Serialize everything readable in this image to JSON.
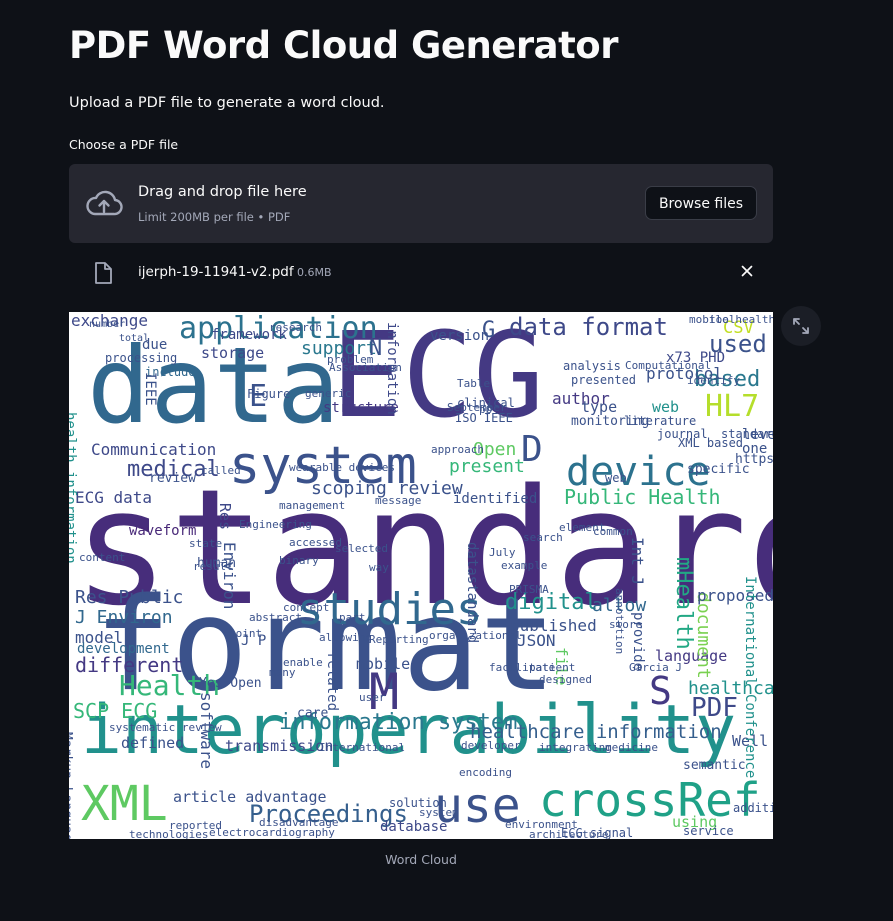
{
  "page": {
    "title": "PDF Word Cloud Generator",
    "description": "Upload a PDF file to generate a word cloud."
  },
  "uploader": {
    "label": "Choose a PDF file",
    "dropzone_text": "Drag and drop file here",
    "limit_text": "Limit 200MB per file • PDF",
    "browse_label": "Browse files",
    "upload_icon": "cloud-upload-icon"
  },
  "file": {
    "name": "ijerph-19-11941-v2.pdf",
    "size": "0.6MB",
    "icon": "file-icon",
    "remove_icon": "close-icon"
  },
  "wordcloud": {
    "caption": "Word Cloud",
    "expand_icon": "fullscreen-expand-icon",
    "background": "#ffffff",
    "palette": "viridis",
    "words": [
      {
        "text": "standard",
        "color": "#472d7b"
      },
      {
        "text": "format",
        "color": "#3b528b"
      },
      {
        "text": "data",
        "color": "#31688e"
      },
      {
        "text": "ECG",
        "color": "#443983"
      },
      {
        "text": "interoperability",
        "color": "#21918c"
      },
      {
        "text": "system",
        "color": "#3b528b"
      },
      {
        "text": "studies",
        "color": "#31688e"
      },
      {
        "text": "device",
        "color": "#2c728e"
      },
      {
        "text": "crossRef",
        "color": "#1fa187"
      },
      {
        "text": "use",
        "color": "#3b528b"
      },
      {
        "text": "XML",
        "color": "#5ec962"
      },
      {
        "text": "application",
        "color": "#2c728e"
      },
      {
        "text": "data format",
        "color": "#3e4989"
      },
      {
        "text": "information system",
        "color": "#2a788e"
      },
      {
        "text": "Health",
        "color": "#35b779"
      },
      {
        "text": "Proceedings",
        "color": "#355f8d"
      },
      {
        "text": "HL7",
        "color": "#b5de2b"
      },
      {
        "text": "used",
        "color": "#3b528b"
      },
      {
        "text": "based",
        "color": "#2a788e"
      },
      {
        "text": "medical",
        "color": "#3e4989"
      },
      {
        "text": "Public Health",
        "color": "#35b779"
      },
      {
        "text": "scoping review",
        "color": "#3b528b"
      },
      {
        "text": "digital",
        "color": "#21918c"
      },
      {
        "text": "SCP ECG",
        "color": "#35b779"
      },
      {
        "text": "different",
        "color": "#443983"
      },
      {
        "text": "PDF",
        "color": "#3e4989"
      },
      {
        "text": "Res Public",
        "color": "#3b528b"
      },
      {
        "text": "J Environ",
        "color": "#31688e"
      },
      {
        "text": "mHealth",
        "color": "#22a884"
      },
      {
        "text": "healthcare information",
        "color": "#355f8d"
      },
      {
        "text": "exchange",
        "color": "#3e4989"
      },
      {
        "text": "support",
        "color": "#2a788e"
      },
      {
        "text": "Communication",
        "color": "#3e4989"
      },
      {
        "text": "ECG data",
        "color": "#3e4989"
      },
      {
        "text": "article advantage",
        "color": "#3b528b"
      },
      {
        "text": "published",
        "color": "#3b528b"
      },
      {
        "text": "language",
        "color": "#443983"
      },
      {
        "text": "document",
        "color": "#7ad151"
      },
      {
        "text": "healthcare",
        "color": "#21918c"
      },
      {
        "text": "model",
        "color": "#3b528b"
      },
      {
        "text": "waveform",
        "color": "#482878"
      },
      {
        "text": "author",
        "color": "#443983"
      },
      {
        "text": "web",
        "color": "#21918c"
      },
      {
        "text": "present",
        "color": "#35b779"
      },
      {
        "text": "allow",
        "color": "#31688e"
      },
      {
        "text": "proposed",
        "color": "#3b528b"
      },
      {
        "text": "database",
        "color": "#3e4989"
      },
      {
        "text": "JSON",
        "color": "#3b528b"
      },
      {
        "text": "storage",
        "color": "#3e4989"
      },
      {
        "text": "protocol",
        "color": "#3b528b"
      },
      {
        "text": "framework",
        "color": "#3e4989"
      },
      {
        "text": "mobile",
        "color": "#3b528b"
      },
      {
        "text": "Open",
        "color": "#5ec962"
      },
      {
        "text": "x73 PHD",
        "color": "#3e4989"
      },
      {
        "text": "version",
        "color": "#3b528b"
      },
      {
        "text": "CSV",
        "color": "#c2df23"
      },
      {
        "text": "structure",
        "color": "#443983"
      },
      {
        "text": "transmission",
        "color": "#3e4989"
      },
      {
        "text": "development",
        "color": "#31688e"
      },
      {
        "text": "identified",
        "color": "#3b528b"
      },
      {
        "text": "due",
        "color": "#3b528b"
      },
      {
        "text": "processing",
        "color": "#3b528b"
      },
      {
        "text": "include",
        "color": "#31688e"
      },
      {
        "text": "level",
        "color": "#3b528b"
      },
      {
        "text": "one",
        "color": "#3b528b"
      },
      {
        "text": "file",
        "color": "#5ec962"
      },
      {
        "text": "defined",
        "color": "#3b528b"
      },
      {
        "text": "Well",
        "color": "#3b528b"
      },
      {
        "text": "using",
        "color": "#5ec962"
      },
      {
        "text": "M",
        "color": "#443983"
      },
      {
        "text": "S",
        "color": "#443983"
      },
      {
        "text": "D",
        "color": "#3b528b"
      },
      {
        "text": "E",
        "color": "#3b528b"
      },
      {
        "text": "N",
        "color": "#3b528b"
      },
      {
        "text": "G",
        "color": "#3b528b"
      },
      {
        "text": "Res",
        "color": "#3e4989"
      },
      {
        "text": "Environ",
        "color": "#3b528b"
      },
      {
        "text": "information",
        "color": "#3e4989"
      },
      {
        "text": "International Conference",
        "color": "#21918c"
      },
      {
        "text": "Int J",
        "color": "#3b528b"
      },
      {
        "text": "provide",
        "color": "#3b528b"
      },
      {
        "text": "datastandard",
        "color": "#3b528b"
      },
      {
        "text": "software",
        "color": "#3b528b"
      },
      {
        "text": "related",
        "color": "#3b528b"
      },
      {
        "text": "IEEE",
        "color": "#3b528b"
      },
      {
        "text": "health information",
        "color": "#21918c"
      },
      {
        "text": "Markup Language",
        "color": "#3b528b"
      },
      {
        "text": "human",
        "color": "#3b528b"
      },
      {
        "text": "review",
        "color": "#3b528b"
      },
      {
        "text": "care",
        "color": "#3b528b"
      },
      {
        "text": "Yes Open",
        "color": "#3b528b"
      },
      {
        "text": "specific",
        "color": "#3b528b"
      },
      {
        "text": "https",
        "color": "#3b528b"
      },
      {
        "text": "semantic",
        "color": "#3b528b"
      },
      {
        "text": "addition",
        "color": "#3b528b"
      },
      {
        "text": "service",
        "color": "#3b528b"
      },
      {
        "text": "solution",
        "color": "#3b528b"
      },
      {
        "text": "architecture",
        "color": "#3b528b"
      },
      {
        "text": "ECG signal",
        "color": "#3b528b"
      },
      {
        "text": "electrocardiography",
        "color": "#3b528b"
      },
      {
        "text": "J P",
        "color": "#3b528b"
      },
      {
        "text": "Figure",
        "color": "#3b528b"
      },
      {
        "text": "web",
        "color": "#3b528b"
      },
      {
        "text": "monitoring",
        "color": "#3b528b"
      },
      {
        "text": "mobile health",
        "color": "#3b528b"
      },
      {
        "text": "analysis",
        "color": "#3b528b"
      },
      {
        "text": "ISO IEEE",
        "color": "#3b528b"
      },
      {
        "text": "clinical",
        "color": "#3b528b"
      },
      {
        "text": "standardization",
        "color": "#3b528b"
      },
      {
        "text": "literature",
        "color": "#3b528b"
      },
      {
        "text": "journal",
        "color": "#3b528b"
      },
      {
        "text": "XML based",
        "color": "#3b528b"
      },
      {
        "text": "type",
        "color": "#3b528b"
      },
      {
        "text": "tool",
        "color": "#3b528b"
      },
      {
        "text": "presented",
        "color": "#3b528b"
      },
      {
        "text": "identify",
        "color": "#3b528b"
      },
      {
        "text": "Table",
        "color": "#3b528b"
      },
      {
        "text": "September",
        "color": "#3b528b"
      },
      {
        "text": "pp",
        "color": "#3b528b"
      },
      {
        "text": "Association",
        "color": "#3b528b"
      },
      {
        "text": "research",
        "color": "#3b528b"
      },
      {
        "text": "problem",
        "color": "#3b528b"
      },
      {
        "text": "generic",
        "color": "#3b528b"
      },
      {
        "text": "approach",
        "color": "#3b528b"
      },
      {
        "text": "management",
        "color": "#3b528b"
      },
      {
        "text": "wearable devices",
        "color": "#3b528b"
      },
      {
        "text": "Engineering",
        "color": "#3b528b"
      },
      {
        "text": "Computational",
        "color": "#3b528b"
      },
      {
        "text": "July",
        "color": "#3b528b"
      },
      {
        "text": "example",
        "color": "#3b528b"
      },
      {
        "text": "patient",
        "color": "#3b528b"
      },
      {
        "text": "facilitate",
        "color": "#3b528b"
      },
      {
        "text": "designed",
        "color": "#3b528b"
      },
      {
        "text": "PRISMA",
        "color": "#3b528b"
      },
      {
        "text": "organizational",
        "color": "#3b528b"
      },
      {
        "text": "environment",
        "color": "#3b528b"
      },
      {
        "text": "encoding",
        "color": "#3b528b"
      },
      {
        "text": "medicine",
        "color": "#3b528b"
      },
      {
        "text": "Garcia J",
        "color": "#3b528b"
      },
      {
        "text": "store",
        "color": "#3b528b"
      },
      {
        "text": "common",
        "color": "#3b528b"
      },
      {
        "text": "annotation",
        "color": "#3b528b"
      },
      {
        "text": "search",
        "color": "#3b528b"
      },
      {
        "text": "selected",
        "color": "#3b528b"
      },
      {
        "text": "concept",
        "color": "#3b528b"
      },
      {
        "text": "point",
        "color": "#3b528b"
      },
      {
        "text": "result",
        "color": "#3b528b"
      },
      {
        "text": "state",
        "color": "#3b528b"
      },
      {
        "text": "called",
        "color": "#3b528b"
      },
      {
        "text": "content",
        "color": "#3b528b"
      },
      {
        "text": "message",
        "color": "#3b528b"
      },
      {
        "text": "way",
        "color": "#3b528b"
      },
      {
        "text": "part",
        "color": "#3b528b"
      },
      {
        "text": "element",
        "color": "#3b528b"
      },
      {
        "text": "developer",
        "color": "#3b528b"
      },
      {
        "text": "accessed",
        "color": "#3b528b"
      },
      {
        "text": "binary",
        "color": "#3b528b"
      },
      {
        "text": "integrating",
        "color": "#3b528b"
      },
      {
        "text": "system",
        "color": "#3b528b"
      },
      {
        "text": "user",
        "color": "#3b528b"
      },
      {
        "text": "many",
        "color": "#3b528b"
      },
      {
        "text": "enable",
        "color": "#3b528b"
      },
      {
        "text": "number",
        "color": "#3b528b"
      },
      {
        "text": "total",
        "color": "#3b528b"
      },
      {
        "text": "International",
        "color": "#3b528b"
      },
      {
        "text": "abstract",
        "color": "#3b528b"
      },
      {
        "text": "allowing",
        "color": "#3b528b"
      },
      {
        "text": "Reporting",
        "color": "#3b528b"
      },
      {
        "text": "systematic review",
        "color": "#3b528b"
      },
      {
        "text": "reported",
        "color": "#3b528b"
      },
      {
        "text": "technologies",
        "color": "#3b528b"
      },
      {
        "text": "disadvantage",
        "color": "#3b528b"
      }
    ]
  }
}
